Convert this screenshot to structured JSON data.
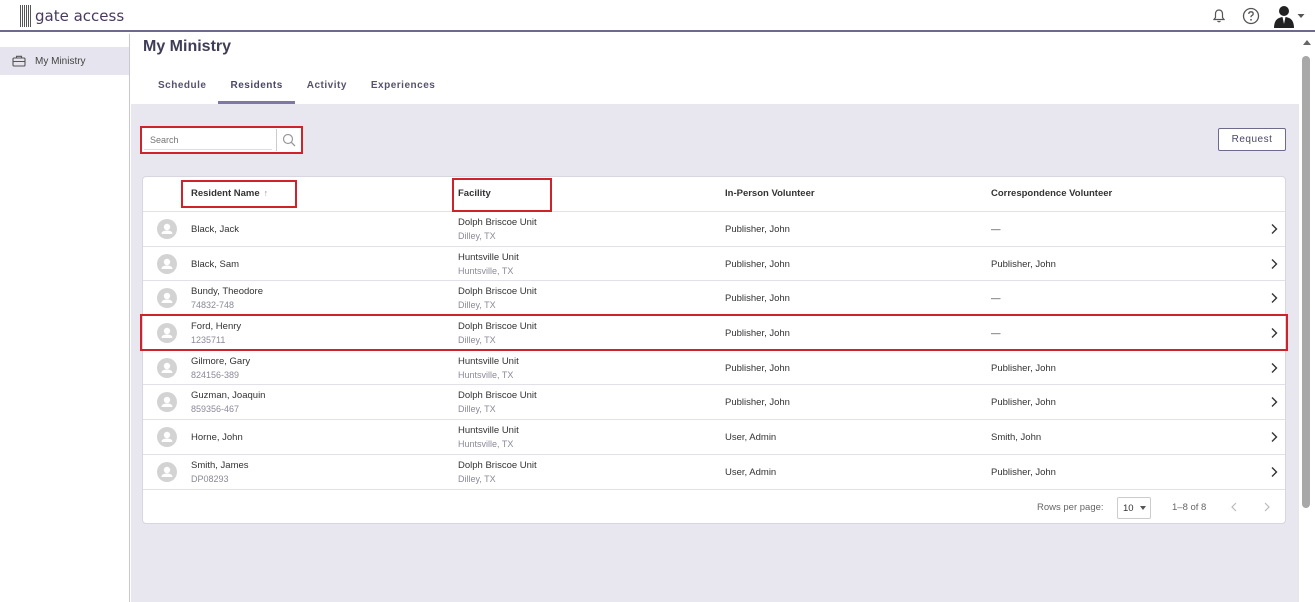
{
  "app": {
    "logo_text": "gate access"
  },
  "sidebar": {
    "items": [
      {
        "label": "My Ministry",
        "icon": "briefcase-icon"
      }
    ]
  },
  "page": {
    "title": "My Ministry",
    "tabs": [
      {
        "label": "Schedule"
      },
      {
        "label": "Residents",
        "active": true
      },
      {
        "label": "Activity"
      },
      {
        "label": "Experiences"
      }
    ]
  },
  "search": {
    "placeholder": "Search"
  },
  "toolbar": {
    "request_label": "Request"
  },
  "table": {
    "columns": [
      "Resident Name",
      "Facility",
      "In-Person Volunteer",
      "Correspondence Volunteer"
    ],
    "sort_column": "Resident Name",
    "rows": [
      {
        "name": "Black, Jack",
        "id": "",
        "facility": "Dolph Briscoe Unit",
        "city": "Dilley, TX",
        "in_person": "Publisher, John",
        "correspondence": "—"
      },
      {
        "name": "Black, Sam",
        "id": "",
        "facility": "Huntsville Unit",
        "city": "Huntsville, TX",
        "in_person": "Publisher, John",
        "correspondence": "Publisher, John"
      },
      {
        "name": "Bundy, Theodore",
        "id": "74832-748",
        "facility": "Dolph Briscoe Unit",
        "city": "Dilley, TX",
        "in_person": "Publisher, John",
        "correspondence": "—"
      },
      {
        "name": "Ford, Henry",
        "id": "1235711",
        "facility": "Dolph Briscoe Unit",
        "city": "Dilley, TX",
        "in_person": "Publisher, John",
        "correspondence": "—"
      },
      {
        "name": "Gilmore, Gary",
        "id": "824156-389",
        "facility": "Huntsville Unit",
        "city": "Huntsville, TX",
        "in_person": "Publisher, John",
        "correspondence": "Publisher, John"
      },
      {
        "name": "Guzman, Joaquin",
        "id": "859356-467",
        "facility": "Dolph Briscoe Unit",
        "city": "Dilley, TX",
        "in_person": "Publisher, John",
        "correspondence": "Publisher, John"
      },
      {
        "name": "Horne, John",
        "id": "",
        "facility": "Huntsville Unit",
        "city": "Huntsville, TX",
        "in_person": "User, Admin",
        "correspondence": "Smith, John"
      },
      {
        "name": "Smith, James",
        "id": "DP08293",
        "facility": "Dolph Briscoe Unit",
        "city": "Dilley, TX",
        "in_person": "User, Admin",
        "correspondence": "Publisher, John"
      }
    ]
  },
  "pagination": {
    "rows_per_page_label": "Rows per page:",
    "rows_per_page": "10",
    "range": "1–8 of 8"
  },
  "colors": {
    "accent": "#6e6a8c",
    "highlight": "#d0222a",
    "background": "#e8e6ef"
  }
}
